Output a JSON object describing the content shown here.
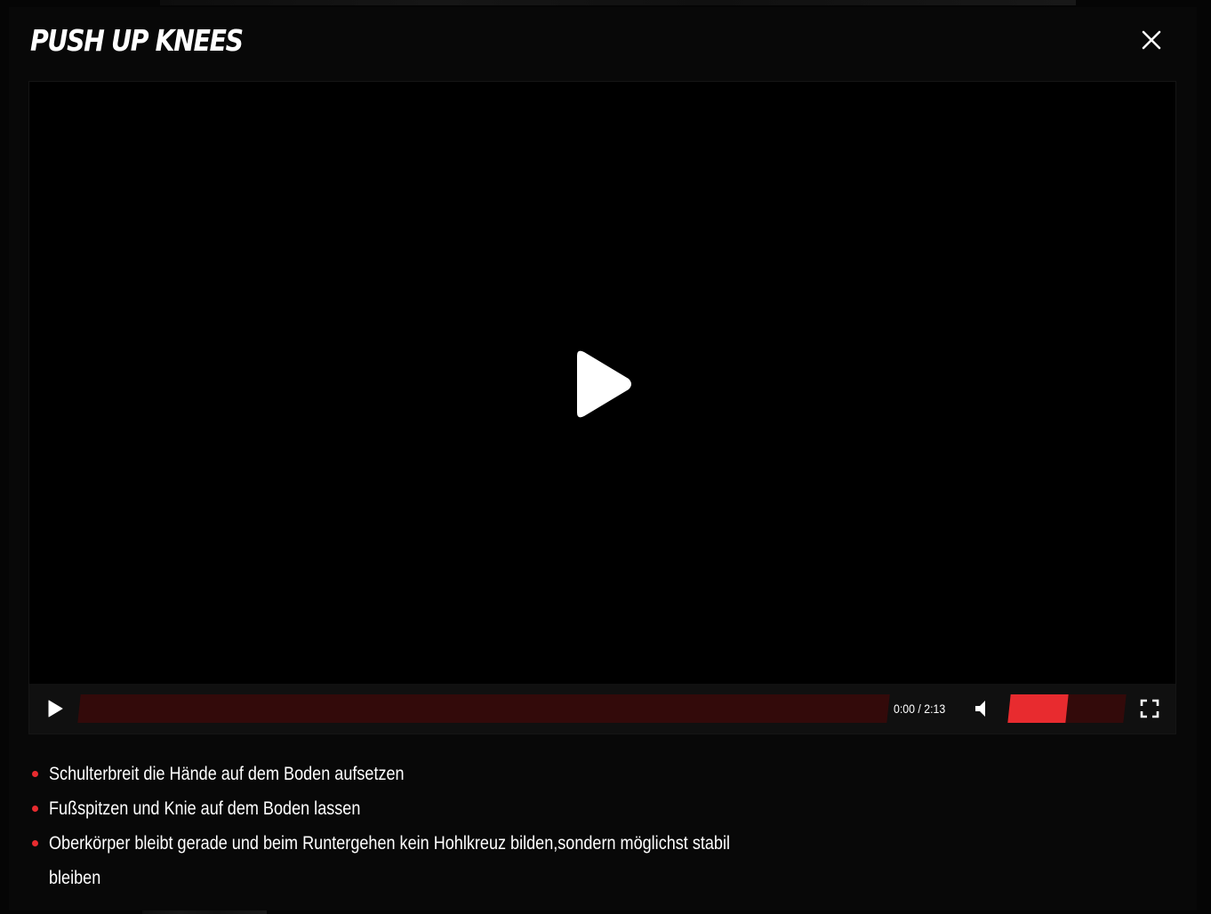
{
  "modal": {
    "title": "PUSH UP KNEES"
  },
  "player": {
    "current_time": "0:00",
    "duration": "2:13",
    "time_display": "0:00 / 2:13",
    "progress_fraction": 0.0,
    "volume_fraction": 0.5,
    "muted": false
  },
  "instructions": [
    "Schulterbreit die Hände auf dem Boden aufsetzen",
    "Fußspitzen und Knie auf dem Boden lassen",
    "Oberkörper bleibt gerade und beim Runtergehen kein Hohlkreuz bilden,sondern möglichst stabil bleiben"
  ],
  "icons": {
    "close": "close-icon",
    "big_play": "play-icon",
    "control_play": "play-icon",
    "mute": "volume-icon",
    "fullscreen": "fullscreen-icon"
  },
  "colors": {
    "accent": "#e82b2f",
    "track": "#330a0a",
    "modal_bg": "#080808",
    "video_bg": "#000000",
    "controls_bg": "#101010"
  }
}
